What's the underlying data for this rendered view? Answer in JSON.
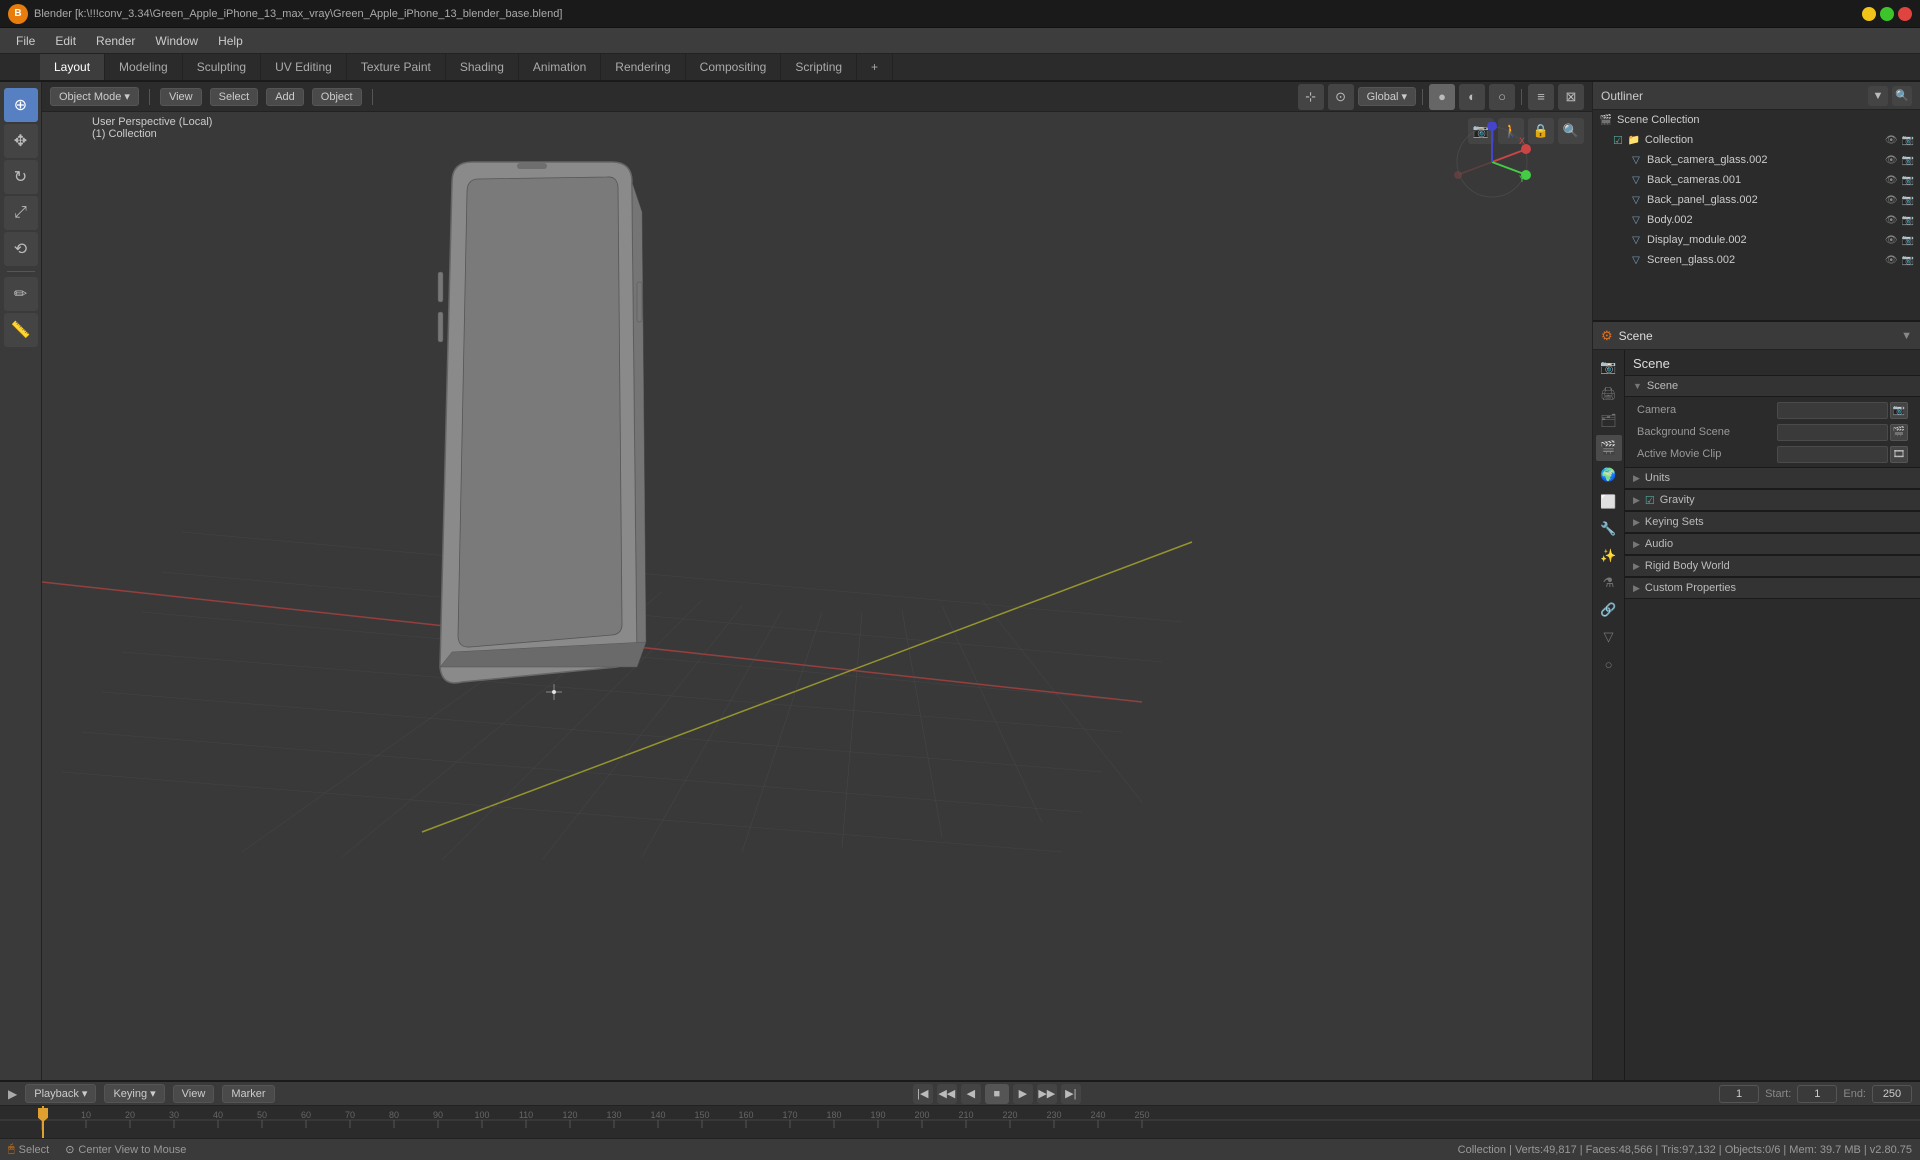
{
  "titlebar": {
    "title": "Blender [k:\\!!!conv_3.34\\Green_Apple_iPhone_13_max_vray\\Green_Apple_iPhone_13_blender_base.blend]",
    "logo": "B"
  },
  "menu": {
    "items": [
      "File",
      "Edit",
      "Render",
      "Window",
      "Help"
    ]
  },
  "workspaceTabs": {
    "tabs": [
      "Layout",
      "Modeling",
      "Sculpting",
      "UV Editing",
      "Texture Paint",
      "Shading",
      "Animation",
      "Rendering",
      "Compositing",
      "Scripting"
    ],
    "active": "Layout",
    "add_label": "+"
  },
  "viewport": {
    "mode_label": "Object Mode",
    "view_label": "View",
    "select_label": "Select",
    "add_label": "Add",
    "object_label": "Object",
    "transform_label": "Global",
    "info_line1": "User Perspective (Local)",
    "info_line2": "(1) Collection"
  },
  "outliner": {
    "title": "Outliner",
    "items": [
      {
        "name": "Scene Collection",
        "level": 0,
        "type": "scene"
      },
      {
        "name": "Collection",
        "level": 1,
        "type": "collection"
      },
      {
        "name": "Back_camera_glass.002",
        "level": 2,
        "type": "mesh"
      },
      {
        "name": "Back_cameras.001",
        "level": 2,
        "type": "mesh"
      },
      {
        "name": "Back_panel_glass.002",
        "level": 2,
        "type": "mesh"
      },
      {
        "name": "Body.002",
        "level": 2,
        "type": "mesh"
      },
      {
        "name": "Display_module.002",
        "level": 2,
        "type": "mesh"
      },
      {
        "name": "Screen_glass.002",
        "level": 2,
        "type": "mesh"
      }
    ]
  },
  "properties": {
    "panel_title": "Scene",
    "scene_label": "Scene",
    "scene_name": "Scene",
    "sections": [
      {
        "label": "Scene",
        "collapsed": false,
        "rows": [
          {
            "label": "Camera",
            "value": "",
            "icon": "📷"
          },
          {
            "label": "Background Scene",
            "value": "",
            "icon": "🎬"
          },
          {
            "label": "Active Movie Clip",
            "value": "",
            "icon": "🎞"
          }
        ]
      },
      {
        "label": "Units",
        "collapsed": true
      },
      {
        "label": "Gravity",
        "collapsed": false,
        "has_check": true
      },
      {
        "label": "Keying Sets",
        "collapsed": true
      },
      {
        "label": "Audio",
        "collapsed": true
      },
      {
        "label": "Rigid Body World",
        "collapsed": true
      },
      {
        "label": "Custom Properties",
        "collapsed": true
      }
    ]
  },
  "timeline": {
    "playback_label": "Playback",
    "keying_label": "Keying",
    "view_label": "View",
    "marker_label": "Marker",
    "current_frame": "1",
    "start_label": "Start:",
    "start_value": "1",
    "end_label": "End:",
    "end_value": "250",
    "frame_ticks": [
      1,
      10,
      20,
      30,
      40,
      50,
      60,
      70,
      80,
      90,
      100,
      110,
      120,
      130,
      140,
      150,
      160,
      170,
      180,
      190,
      200,
      210,
      220,
      230,
      240,
      250
    ]
  },
  "statusbar": {
    "select_label": "Select",
    "center_label": "Center View to Mouse",
    "stats": "Collection | Verts:49,817 | Faces:48,566 | Tris:97,132 | Objects:0/6 | Mem: 39.7 MB | v2.80.75"
  },
  "icons": {
    "cursor": "⊕",
    "move": "✥",
    "rotate": "↻",
    "scale": "⤢",
    "transform": "⟲",
    "annotate": "✏",
    "measure": "📏"
  }
}
